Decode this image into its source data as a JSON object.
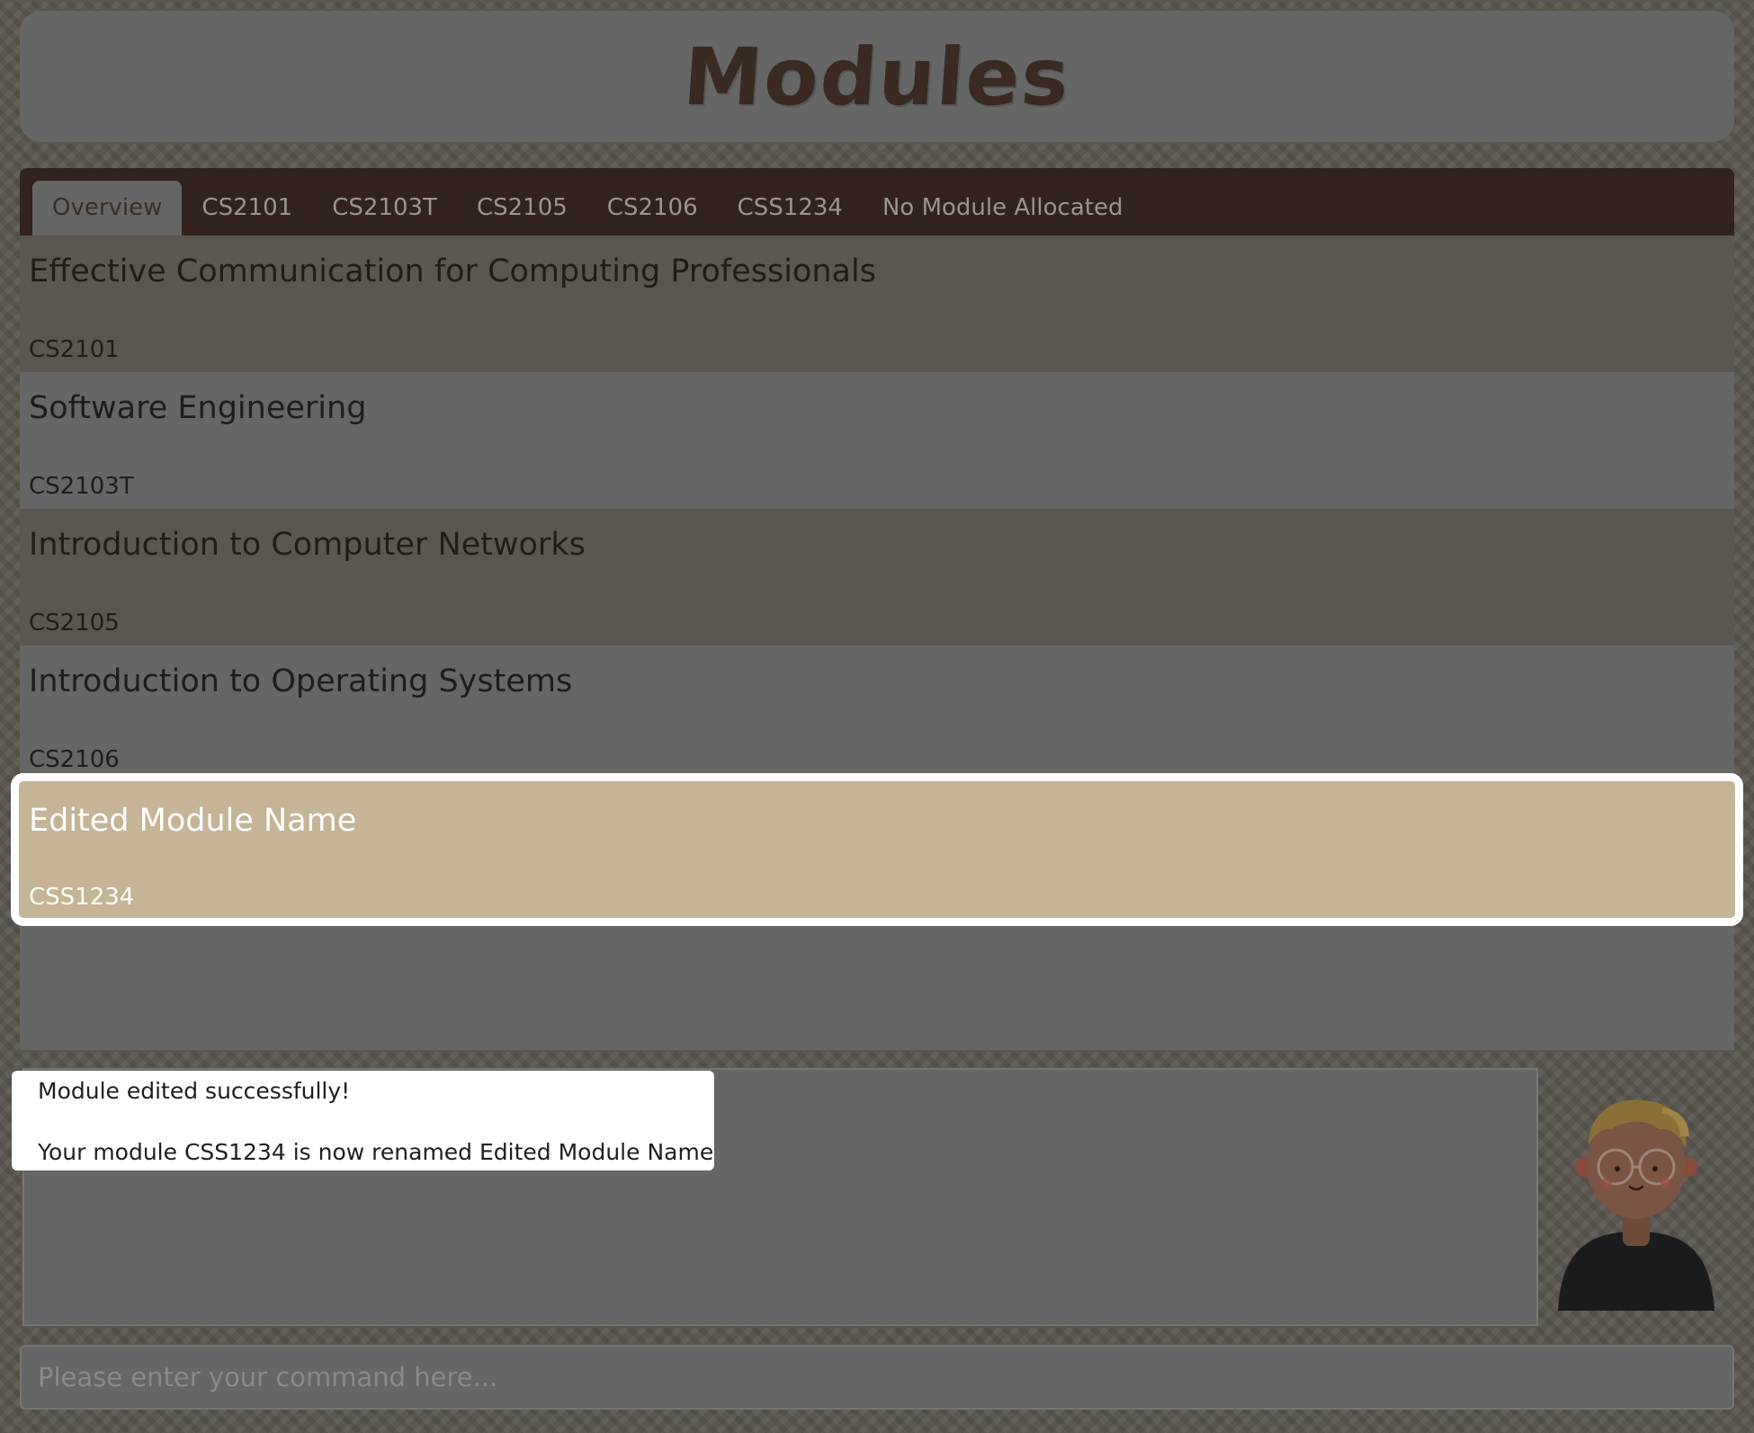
{
  "app": {
    "title": "Modules"
  },
  "tabs": [
    {
      "label": "Overview",
      "active": true
    },
    {
      "label": "CS2101",
      "active": false
    },
    {
      "label": "CS2103T",
      "active": false
    },
    {
      "label": "CS2105",
      "active": false
    },
    {
      "label": "CS2106",
      "active": false
    },
    {
      "label": "CSS1234",
      "active": false
    },
    {
      "label": "No Module Allocated",
      "active": false
    }
  ],
  "modules": [
    {
      "name": "Effective Communication for Computing Professionals",
      "code": "CS2101"
    },
    {
      "name": "Software Engineering",
      "code": "CS2103T"
    },
    {
      "name": "Introduction to Computer Networks",
      "code": "CS2105"
    },
    {
      "name": "Introduction to Operating Systems",
      "code": "CS2106"
    },
    {
      "name": "Edited Module Name",
      "code": "CSS1234",
      "selected": true
    }
  ],
  "feedback": {
    "line1": "Module edited successfully!",
    "line2": "Your module CSS1234 is now renamed Edited Module Name"
  },
  "command": {
    "placeholder": "Please enter your command here..."
  },
  "colors": {
    "background": "#5b5750",
    "panel": "#666666",
    "tab_bar": "#33221d",
    "title_text": "#3a2a22",
    "selected_card": "#c5b495",
    "highlight_border": "#ffffff"
  },
  "icons": {
    "avatar": "user-avatar-icon"
  }
}
